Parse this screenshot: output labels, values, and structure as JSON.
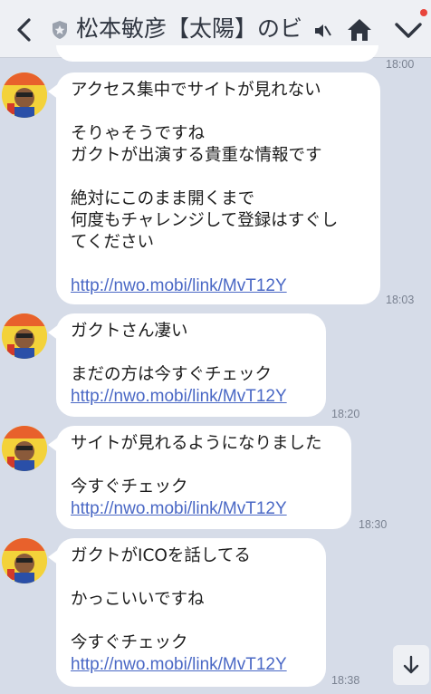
{
  "header": {
    "title": "松本敏彦【太陽】のビ...",
    "icons": [
      "chevron-left-icon",
      "shield-icon",
      "mute-icon",
      "home-icon",
      "chevron-down-icon"
    ],
    "colors": {
      "bar": "#eef0f4",
      "icon": "#2f3540",
      "notification_dot": "#e8453c"
    }
  },
  "previous_message": {
    "time": "18:00"
  },
  "messages": [
    {
      "lines": [
        "アクセス集中でサイトが見れない",
        "",
        "そりゃそうですね",
        "ガクトが出演する貴重な情報です",
        "",
        "絶対にこのまま開くまで",
        "何度もチャレンジして登録はすぐし",
        "てください",
        ""
      ],
      "link": "http://nwo.mobi/link/MvT12Y",
      "time": "18:03"
    },
    {
      "lines": [
        "ガクトさん凄い",
        "",
        "まだの方は今すぐチェック"
      ],
      "link": "http://nwo.mobi/link/MvT12Y",
      "time": "18:20"
    },
    {
      "lines": [
        "サイトが見れるようになりました",
        "",
        "今すぐチェック"
      ],
      "link": "http://nwo.mobi/link/MvT12Y",
      "time": "18:30"
    },
    {
      "lines": [
        "ガクトがICOを話してる",
        "",
        "かっこいいですね",
        "",
        "今すぐチェック"
      ],
      "link": "http://nwo.mobi/link/MvT12Y",
      "time": "18:38"
    }
  ],
  "colors": {
    "background": "#d6dce8",
    "bubble": "#ffffff",
    "link": "#4a68c5",
    "time": "#7a8291"
  }
}
